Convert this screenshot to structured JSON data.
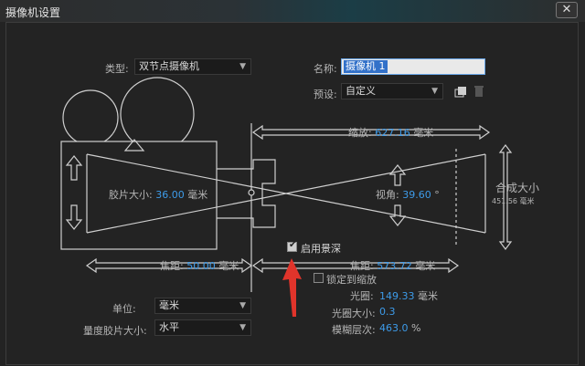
{
  "window": {
    "title": "摄像机设置",
    "close_glyph": "✕"
  },
  "type": {
    "label": "类型:",
    "value": "双节点摄像机"
  },
  "name": {
    "label": "名称:",
    "value": "摄像机 1"
  },
  "preset": {
    "label": "预设:",
    "value": "自定义"
  },
  "zoom": {
    "label": "缩放:",
    "value": "627.16",
    "unit": "毫米"
  },
  "film_size": {
    "label": "胶片大小:",
    "value": "36.00",
    "unit": "毫米"
  },
  "angle": {
    "label": "视角:",
    "value": "39.60",
    "unit": "°"
  },
  "comp_size": {
    "label": "合成大小",
    "value": "451.56",
    "unit": "毫米"
  },
  "dof": {
    "label": "启用景深",
    "checked": true
  },
  "focal": {
    "label": "焦距:",
    "value": "50.00",
    "unit": "毫米"
  },
  "focus_distance": {
    "label": "焦距:",
    "value": "573.72",
    "unit": "毫米"
  },
  "lock_zoom": {
    "label": "锁定到缩放",
    "checked": false
  },
  "aperture": {
    "label": "光圈:",
    "value": "149.33",
    "unit": "毫米"
  },
  "fstop": {
    "label": "光圈大小:",
    "value": "0.3"
  },
  "blur": {
    "label": "模糊层次:",
    "value": "463.0",
    "unit": "%"
  },
  "units": {
    "label": "单位:",
    "value": "毫米"
  },
  "measure_film": {
    "label": "量度胶片大小:",
    "value": "水平"
  },
  "icons": [
    "save-preset-icon",
    "delete-preset-icon",
    "arrow-annotation-icon"
  ],
  "colors": {
    "accent": "#3d9be9",
    "annotation": "#e0342b",
    "line": "#cfcfcf"
  }
}
